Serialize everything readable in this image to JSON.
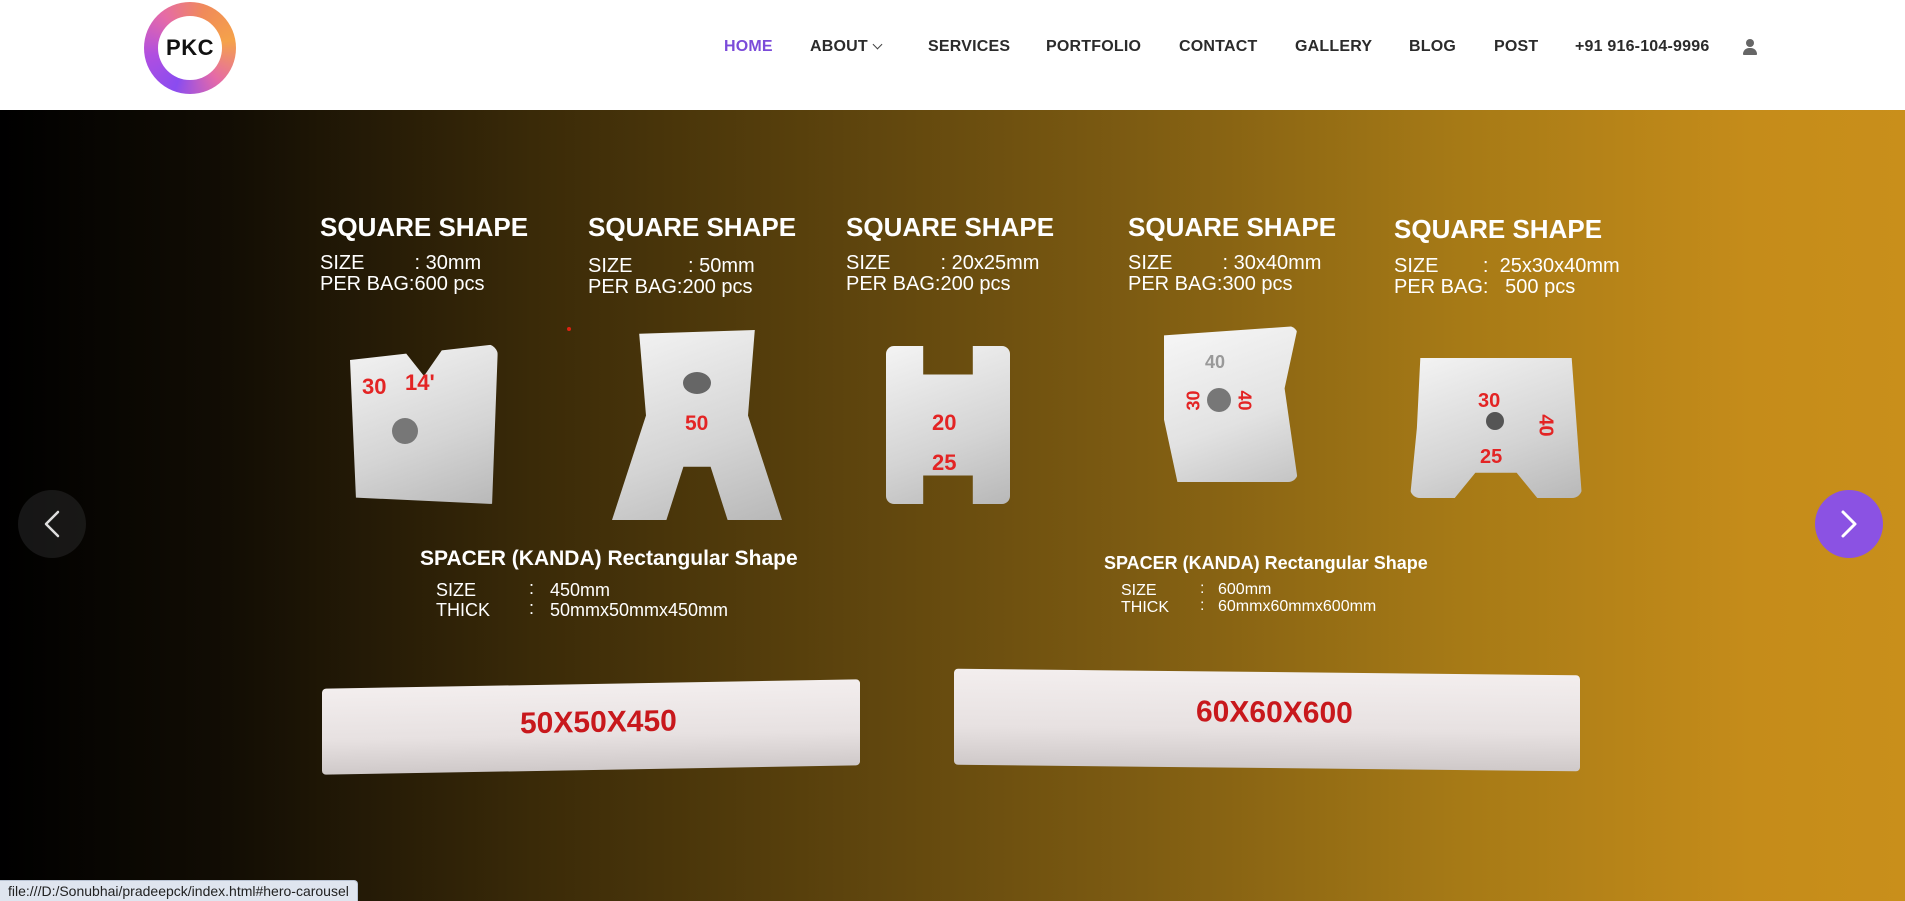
{
  "header": {
    "logo_text": "PKC",
    "nav": [
      {
        "label": "HOME"
      },
      {
        "label": "ABOUT"
      },
      {
        "label": "SERVICES"
      },
      {
        "label": "PORTFOLIO"
      },
      {
        "label": "CONTACT"
      },
      {
        "label": "GALLERY"
      },
      {
        "label": "BLOG"
      },
      {
        "label": "POST"
      },
      {
        "label": "+91 916-104-9996"
      }
    ],
    "active_color": "#7b4bd9"
  },
  "hero": {
    "products": [
      {
        "title": "SQUARE SHAPE",
        "size": "SIZE         : 30mm",
        "per_bag": "PER BAG:600 pcs",
        "marks": [
          "30",
          "14'"
        ]
      },
      {
        "title": "SQUARE SHAPE",
        "size": "SIZE          : 50mm",
        "per_bag": "PER BAG:200 pcs",
        "marks": [
          "50"
        ]
      },
      {
        "title": "SQUARE SHAPE",
        "size": "SIZE         : 20x25mm",
        "per_bag": "PER BAG:200 pcs",
        "marks": [
          "20",
          "25"
        ]
      },
      {
        "title": "SQUARE SHAPE",
        "size": "SIZE         : 30x40mm",
        "per_bag": "PER BAG:300 pcs",
        "marks": [
          "40",
          "30",
          "40"
        ]
      },
      {
        "title": "SQUARE SHAPE",
        "size": "SIZE        :  25x30x40mm",
        "per_bag": "PER BAG:   500 pcs",
        "marks": [
          "30",
          "40",
          "25"
        ]
      }
    ],
    "rectangular": [
      {
        "title": "SPACER (KANDA) Rectangular Shape",
        "size_label": "SIZE",
        "size_sep": ":",
        "size_value": "450mm",
        "thick_label": "THICK",
        "thick_sep": ":",
        "thick_value": "50mmx50mmx450mm",
        "bar_text": "50X50X450"
      },
      {
        "title": "SPACER (KANDA) Rectangular Shape",
        "size_label": "SIZE",
        "size_sep": ":",
        "size_value": "600mm",
        "thick_label": "THICK",
        "thick_sep": ":",
        "thick_value": "60mmx60mmx600mm",
        "bar_text": "60X60X600"
      }
    ],
    "prev_icon": "chevron-left-icon",
    "next_icon": "chevron-right-icon",
    "next_color": "#8b52e3"
  },
  "status_bar": {
    "url": "file:///D:/Sonubhai/pradeepck/index.html#hero-carousel"
  }
}
